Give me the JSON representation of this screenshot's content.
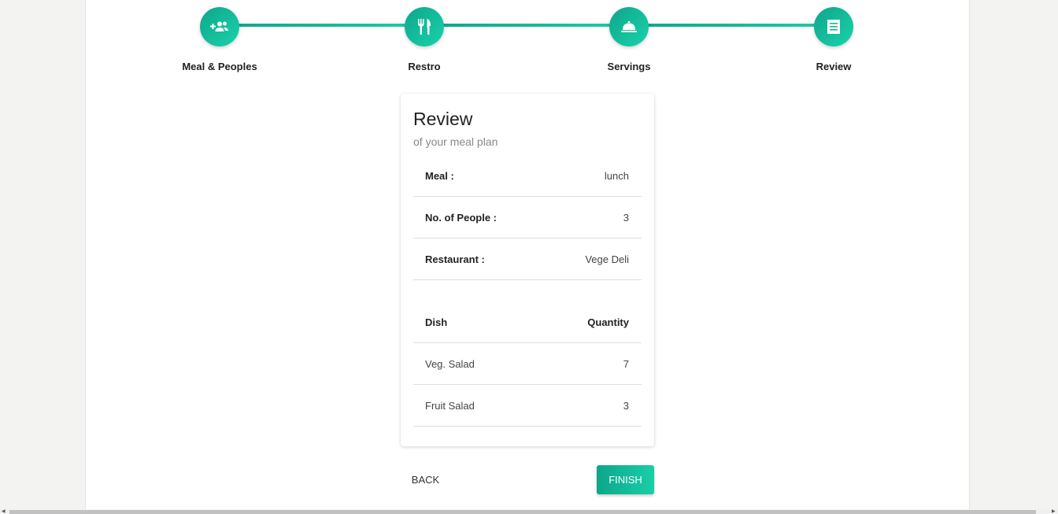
{
  "stepper": {
    "steps": [
      {
        "label": "Meal & Peoples",
        "icon": "add-group-icon"
      },
      {
        "label": "Restro",
        "icon": "fork-knife-icon"
      },
      {
        "label": "Servings",
        "icon": "cloche-icon"
      },
      {
        "label": "Review",
        "icon": "receipt-icon"
      }
    ],
    "active_step": 4
  },
  "review": {
    "title": "Review",
    "subtitle": "of your meal plan",
    "meal_label": "Meal :",
    "meal_value": "lunch",
    "people_label": "No. of People :",
    "people_value": "3",
    "restaurant_label": "Restaurant :",
    "restaurant_value": "Vege Deli",
    "dishes_header": {
      "dish": "Dish",
      "quantity": "Quantity"
    },
    "dishes": [
      {
        "name": "Veg. Salad",
        "quantity": "7"
      },
      {
        "name": "Fruit Salad",
        "quantity": "3"
      }
    ]
  },
  "actions": {
    "back_label": "BACK",
    "finish_label": "FINISH"
  },
  "colors": {
    "accent": "#10b08f",
    "accent_light": "#1cd1aa"
  }
}
